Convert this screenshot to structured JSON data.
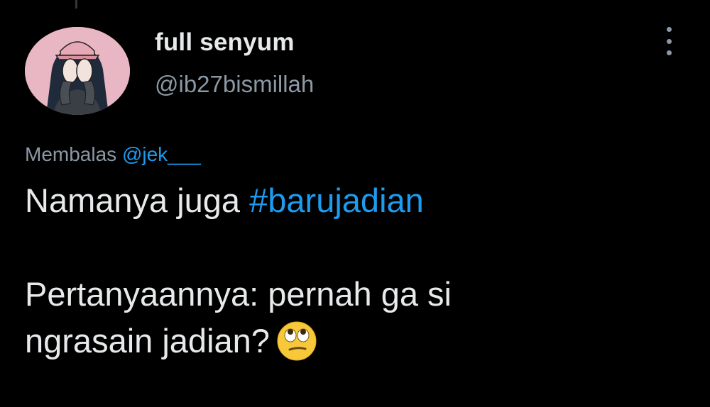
{
  "tweet": {
    "display_name": "full senyum",
    "handle": "@ib27bismillah",
    "reply_prefix": "Membalas",
    "reply_mention": "@jek___",
    "line1_text": "Namanya juga ",
    "hashtag": "#barujadian",
    "line2": "Pertanyaannya: pernah ga si",
    "line3": "ngrasain jadian?",
    "emoji": "face-with-rolling-eyes-icon"
  },
  "colors": {
    "background": "#000000",
    "text": "#e7e9ea",
    "secondary": "#8b98a5",
    "link": "#1d9bf0"
  }
}
